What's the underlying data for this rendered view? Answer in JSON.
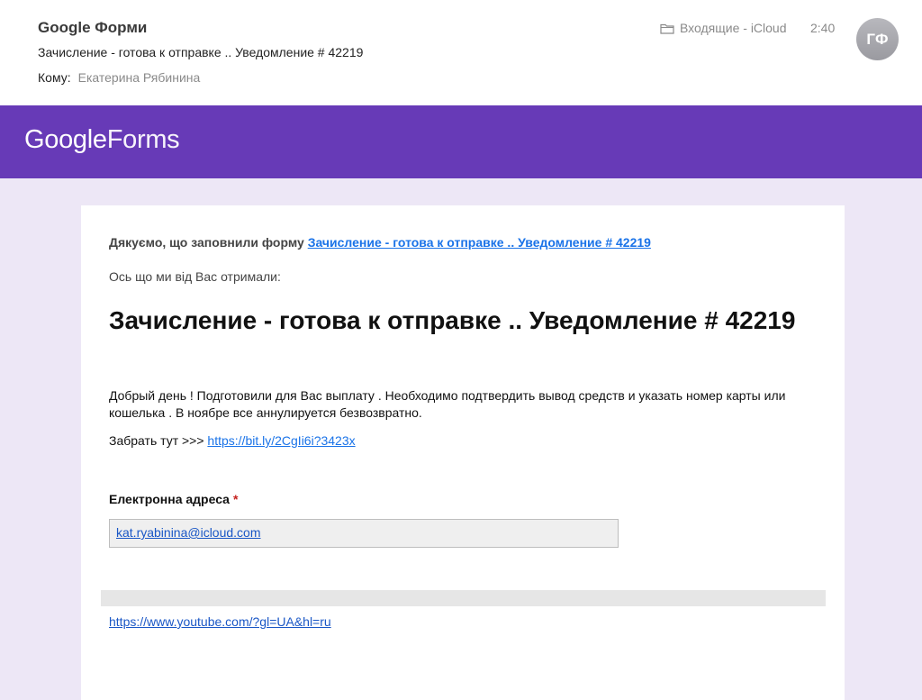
{
  "mail": {
    "sender": "Google Форми",
    "subject": "Зачисление - готова к отправке .. Уведомление # 42219",
    "to_label": "Кому:",
    "to_name": "Екатерина Рябинина",
    "folder": "Входящие - iCloud",
    "time": "2:40",
    "avatar_initials": "ГФ"
  },
  "banner": {
    "logo_google": "Google",
    "logo_forms": "Forms",
    "color": "#673ab7"
  },
  "form": {
    "thanks_text": "Дякуємо, що заповнили форму ",
    "thanks_link": "Зачисление - готова к отправке .. Уведомление # 42219",
    "received_text": "Ось що ми від Вас отримали:",
    "title": "Зачисление - готова к отправке .. Уведомление # 42219",
    "description": "Добрый день ! Подготовили для Вас выплату . Необходимо подтвердить вывод средств и указать номер карты или кошелька . В ноябре все аннулируется безвозвратно.",
    "take_prefix": "Забрать тут >>> ",
    "take_link": "https://bit.ly/2CgIi6i?3423x",
    "email_label": "Електронна адреса",
    "required_mark": "*",
    "email_value": "kat.ryabinina@icloud.com",
    "footer_link": "https://www.youtube.com/?gl=UA&hl=ru"
  },
  "colors": {
    "page_background": "#ede7f6",
    "link": "#1a73e8",
    "required": "#c5221f"
  }
}
